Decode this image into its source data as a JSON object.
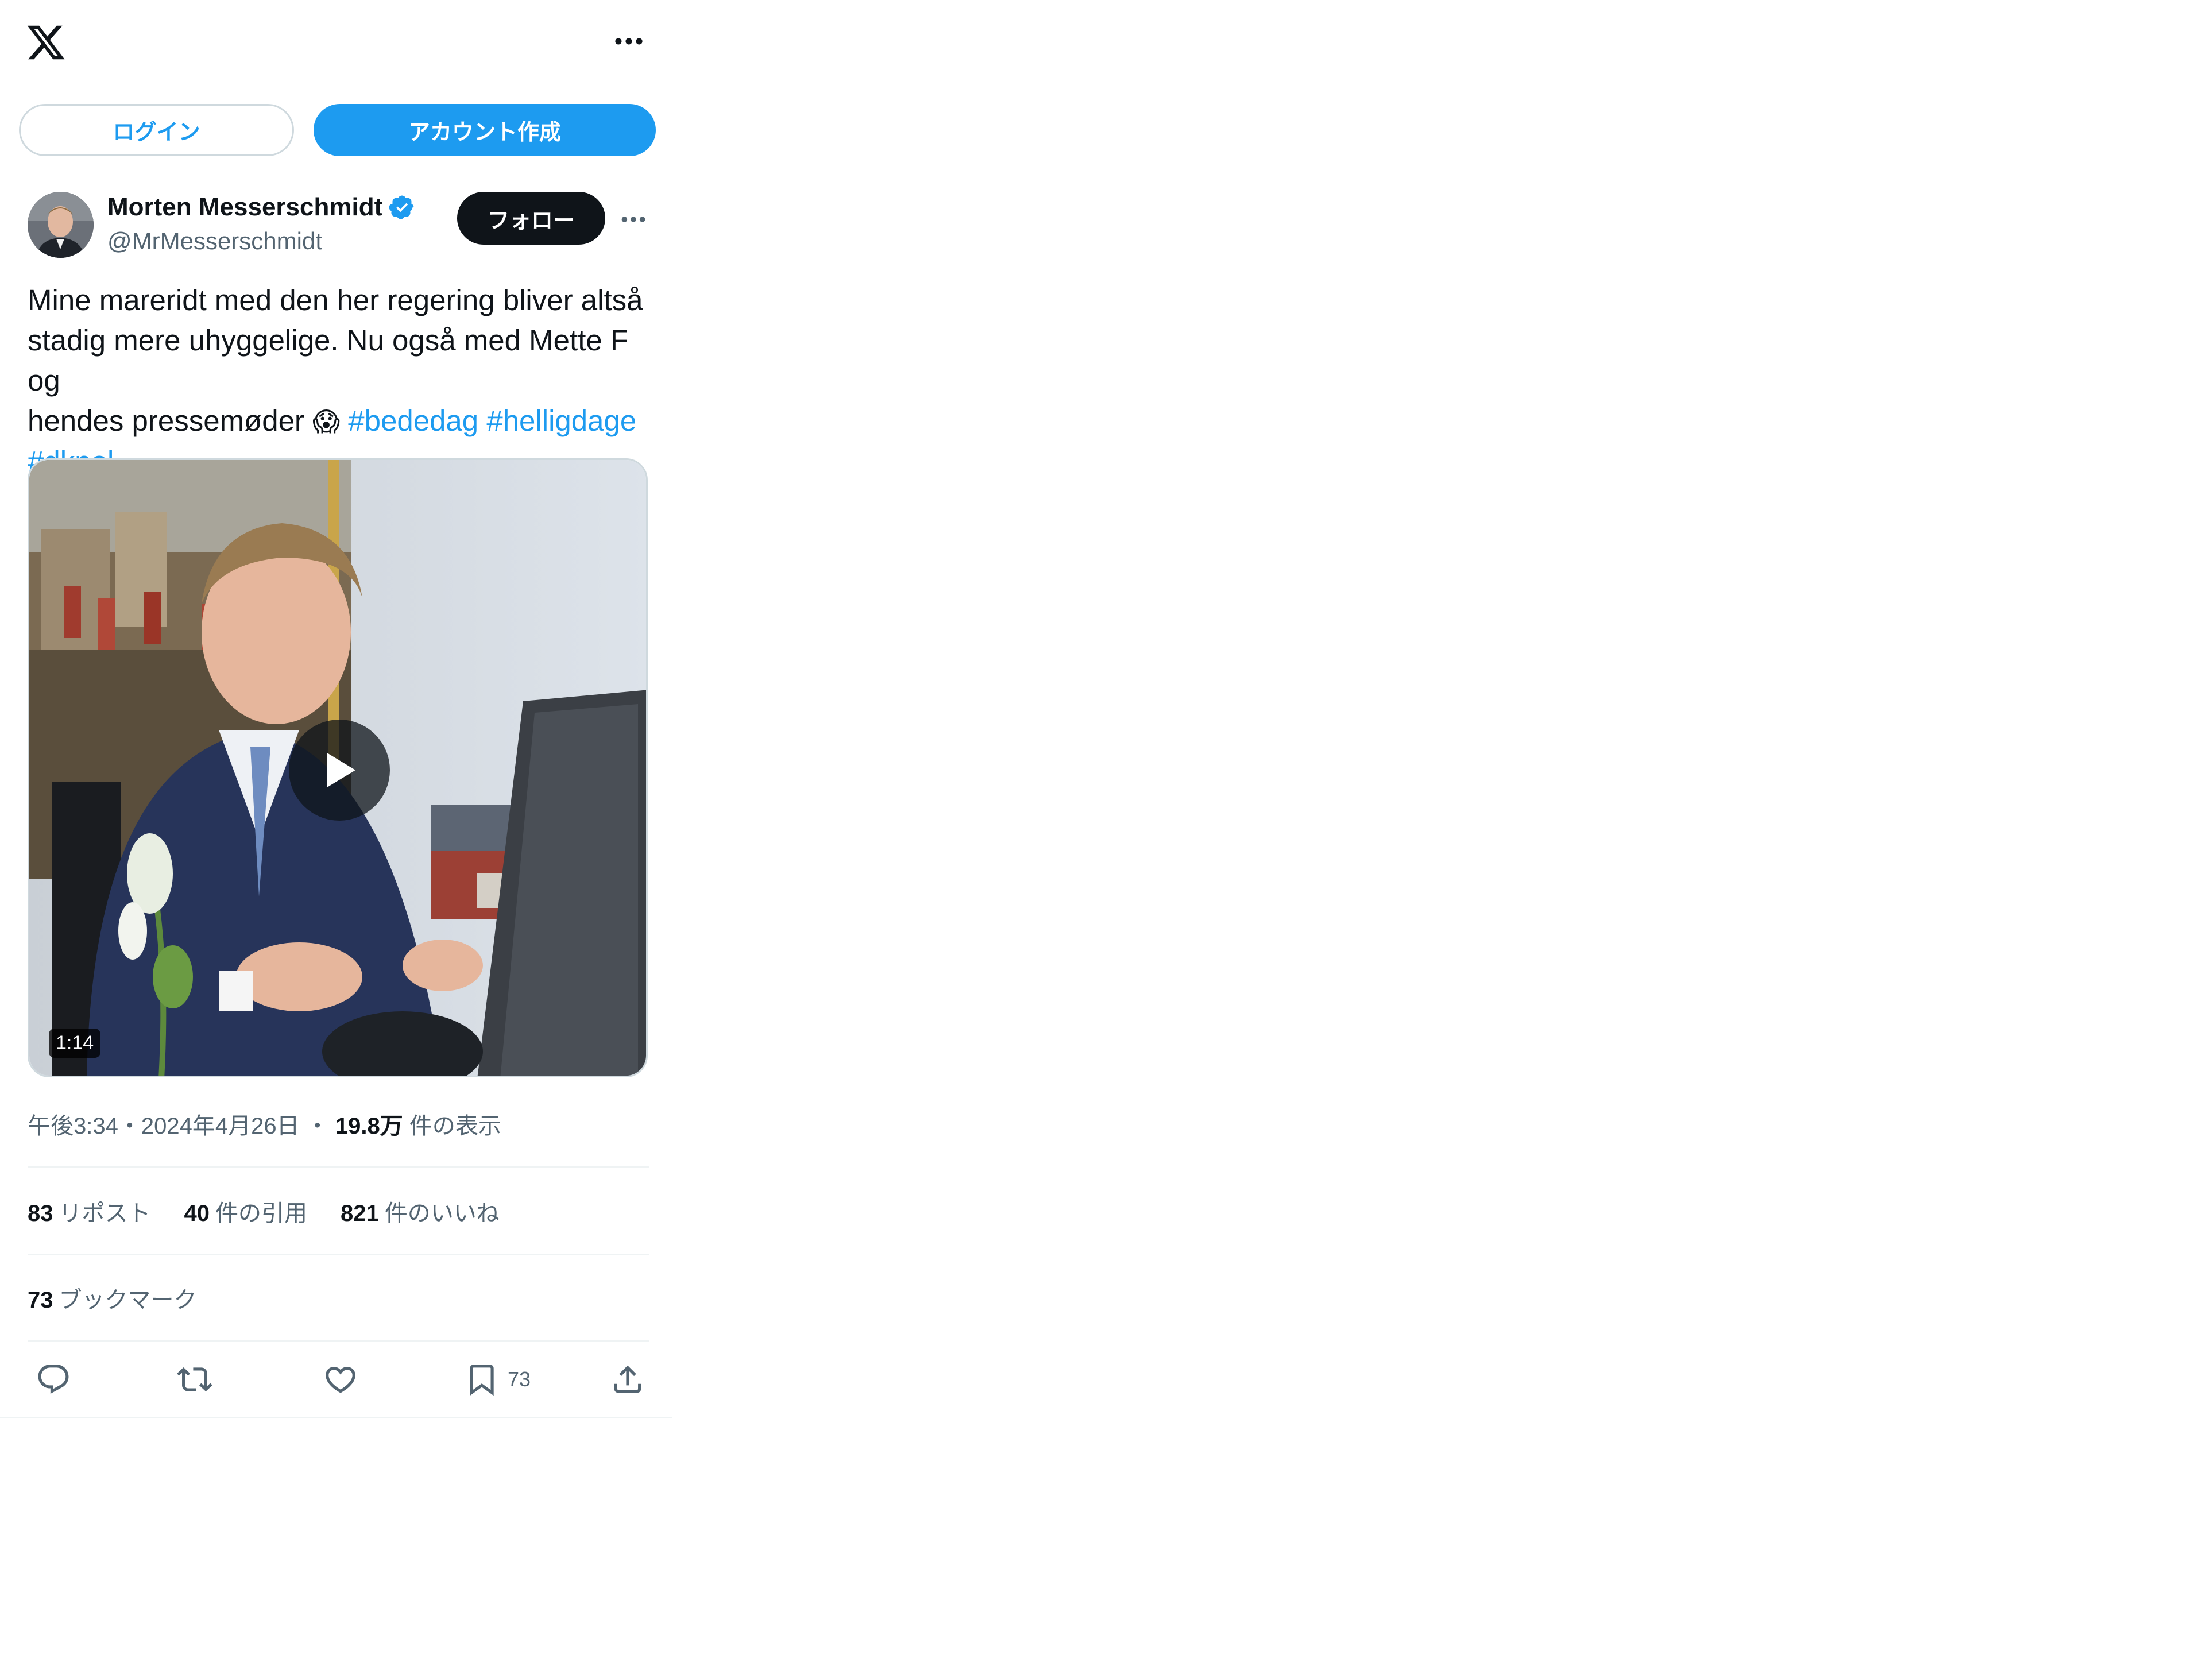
{
  "header": {
    "logo_icon": "x-logo-icon",
    "more_icon": "more-horizontal-icon"
  },
  "auth": {
    "login_label": "ログイン",
    "signup_label": "アカウント作成"
  },
  "author": {
    "name": "Morten Messerschmidt",
    "handle": "@MrMesserschmidt",
    "verified": true,
    "follow_label": "フォロー"
  },
  "tweet": {
    "text_lines": [
      "Mine mareridt med den her regering bliver altså",
      "stadig mere uhyggelige. Nu også med Mette F og",
      "hendes pressemøder "
    ],
    "emoji": "😱",
    "hashtags": [
      "#bededag",
      "#helligdage",
      "#dkpol"
    ]
  },
  "media": {
    "type": "video",
    "duration": "1:14"
  },
  "meta": {
    "time": "午後3:34",
    "separator": "・",
    "date": "2024年4月26日",
    "dot": "・",
    "views_count": "19.8万",
    "views_label": "件の表示"
  },
  "stats": {
    "reposts": {
      "count": "83",
      "label": "リポスト"
    },
    "quotes": {
      "count": "40",
      "label": "件の引用"
    },
    "likes": {
      "count": "821",
      "label": "件のいいね"
    },
    "bookmarks": {
      "count": "73",
      "label": "ブックマーク"
    }
  },
  "actions": {
    "bookmark_count": "73"
  },
  "colors": {
    "accent": "#1d9bf0",
    "text": "#0f1419",
    "secondary": "#536471",
    "border": "#cfd9de"
  }
}
